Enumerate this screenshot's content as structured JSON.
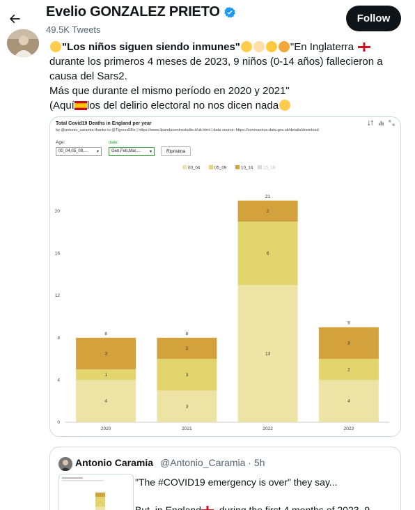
{
  "header": {
    "profile_name": "Evelio GONZALEZ PRIETO",
    "tweet_count": "49.5K Tweets",
    "follow_label": "Follow"
  },
  "tweet": {
    "bold_text": "\"Los niños siguen siendo inmunes\"",
    "text_after_bold": "\"En Inglaterra",
    "line2": "durante los primeros 4 meses de 2023, 9 niños (0-14 años) fallecieron a",
    "line3": "causa del Sars2.",
    "line4": "Más que durante el mismo período en 2020 y 2021\"",
    "line5_start": "(Aquí",
    "line5_end": "los del delirio electoral no nos dicen nada",
    "icons": [
      "flushed-face-emoji",
      "baby-emoji",
      "child-emoji",
      "girl-emoji",
      "england-flag-emoji",
      "spain-flag-emoji",
      "slightly-frowning-face-emoji"
    ]
  },
  "chart_header": {
    "title": "Total Covid19 Deaths in England per year",
    "subtitle": "by @antonio_caramia thanks to @TigressEllie | https://www.ilpandacentrostudio.it/uk.html | data source: https://coronavirus.data.gov.uk/details/download",
    "age_label": "Age:",
    "age_value": "00_04,05_09,...",
    "date_label": "date:",
    "date_value": "Gen,Feb,Mar,...",
    "reset_label": "Ripristina"
  },
  "chart_data": {
    "type": "bar",
    "stacked": true,
    "title": "Total Covid19 Deaths in England per year",
    "categories": [
      "2020",
      "2021",
      "2022",
      "2023"
    ],
    "series": [
      {
        "name": "00_04",
        "values": [
          4,
          3,
          13,
          4
        ],
        "color": "#ece3a4"
      },
      {
        "name": "05_09",
        "values": [
          1,
          3,
          6,
          2
        ],
        "color": "#e2d56e"
      },
      {
        "name": "10_14",
        "values": [
          3,
          2,
          2,
          3
        ],
        "color": "#d4a23c"
      },
      {
        "name": "15_19",
        "values": [
          0,
          0,
          0,
          0
        ],
        "color": "#dddddd",
        "disabled": true
      }
    ],
    "totals": [
      8,
      8,
      21,
      9
    ],
    "ylim": [
      0,
      21
    ],
    "yticks": [
      0,
      4,
      8,
      12,
      16,
      20
    ],
    "legend_position": "top-center",
    "grid": false
  },
  "quote": {
    "name": "Antonio Caramia",
    "handle_time": "@Antonio_Caramia · 5h",
    "text1": "\"The #COVID19 emergency is over\" they say...",
    "text2": "But, in England",
    "text2_end": ", during the first 4 months of 2023, 9"
  },
  "colors": {
    "follow_bg": "#0f1419",
    "verified": "#1d9bf0",
    "muted_text": "#536471",
    "border": "#cfd9de"
  }
}
